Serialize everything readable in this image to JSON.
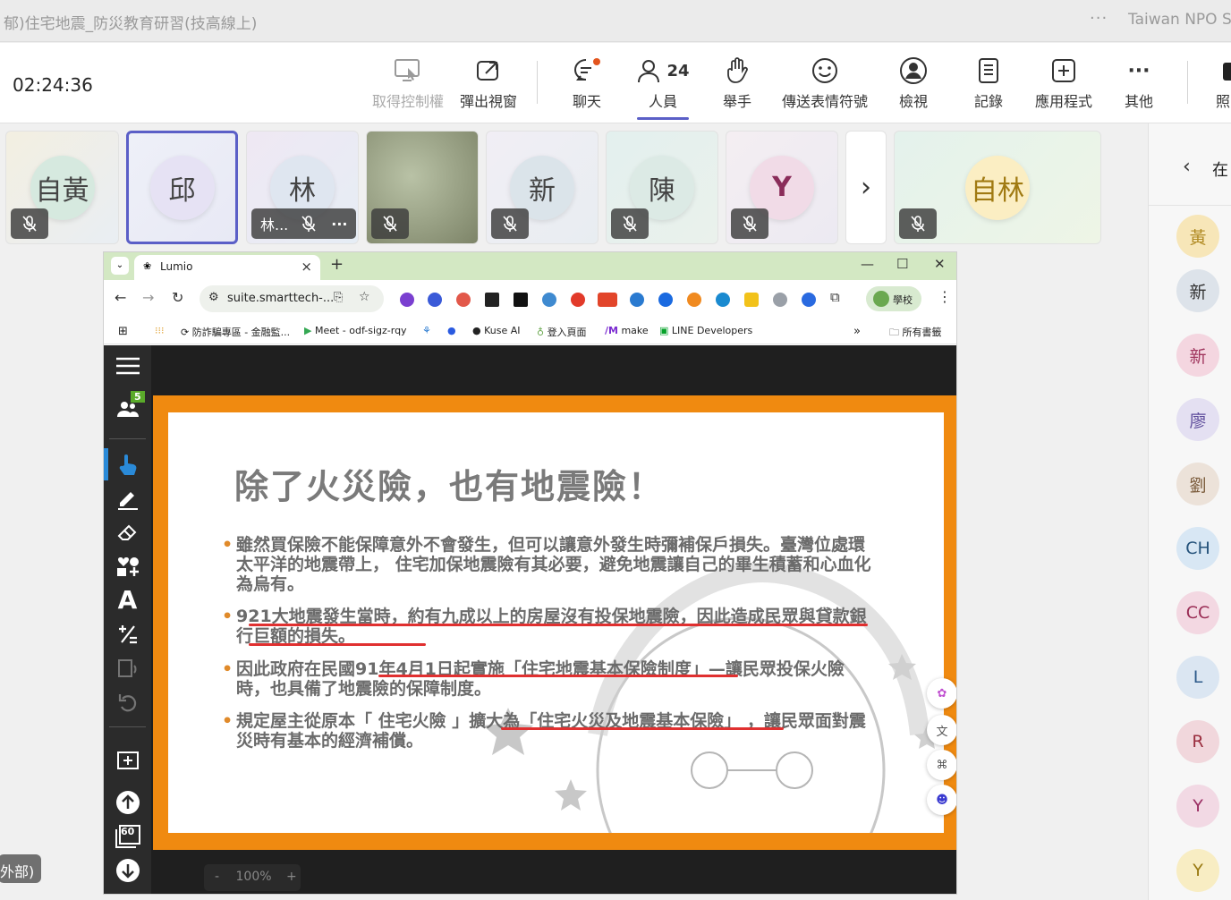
{
  "window": {
    "title": "郁)住宅地震_防災教育研習(技高線上)",
    "more_label": "···",
    "org": "Taiwan NPO Se"
  },
  "toolbar": {
    "timer": "02:24:36",
    "take_control": "取得控制權",
    "popout": "彈出視窗",
    "chat": "聊天",
    "people": "人員",
    "people_count": "24",
    "raise_hand": "舉手",
    "react": "傳送表情符號",
    "view": "檢視",
    "notes": "記錄",
    "apps": "應用程式",
    "more": "其他",
    "camera": "照"
  },
  "tiles": [
    {
      "name": "自黃",
      "color": "#d6e9df"
    },
    {
      "name": "邱",
      "color": "#e6e2f4"
    },
    {
      "name": "林",
      "color": "#dfe6f0",
      "label": "林..."
    },
    {
      "name": "",
      "color": "#9aa58f"
    },
    {
      "name": "新",
      "color": "#dbe4ea"
    },
    {
      "name": "陳",
      "color": "#dceae5"
    },
    {
      "name": "Y",
      "color": "#f1dbe7"
    },
    {
      "name": "自林",
      "color": "#fbeec3"
    }
  ],
  "tiles_next": "›",
  "roster": {
    "back": "‹",
    "title": "在",
    "people": [
      {
        "name": "黃",
        "color": "#f7e6b8"
      },
      {
        "name": "新",
        "color": "#dde3ea"
      },
      {
        "name": "新",
        "color": "#f4d6e0"
      },
      {
        "name": "廖",
        "color": "#e4e0f2"
      },
      {
        "name": "劉",
        "color": "#ece2d9"
      },
      {
        "name": "CH",
        "color": "#d8e7f4"
      },
      {
        "name": "CC",
        "color": "#f3d8e2"
      },
      {
        "name": "L",
        "color": "#dbe6f2"
      },
      {
        "name": "R",
        "color": "#f1d7dc"
      },
      {
        "name": "Y",
        "color": "#f2d9e4"
      },
      {
        "name": "Y",
        "color": "#f8edc3"
      }
    ]
  },
  "browser": {
    "tab_title": "Lumio",
    "url": "suite.smarttech-...",
    "school": "學校",
    "bookmarks": {
      "b1": "防詐騙專區 - 金融監...",
      "b2": "Meet - odf-sigz-rqy",
      "b3": "Kuse AI",
      "b4": "登入頁面",
      "b5": "make",
      "b6": "LINE Developers",
      "more": "»",
      "folder": "所有書籤"
    }
  },
  "lumio": {
    "participants": "5",
    "page_count": "60",
    "zoom": "100%",
    "zoom_minus": "-",
    "zoom_plus": "+"
  },
  "slide": {
    "title": "除了火災險，也有地震險！",
    "b1": "雖然買保險不能保障意外不會發生，但可以讓意外發生時彌補保戶損失。臺灣位處環太平洋的地震帶上， 住宅加保地震險有其必要，避免地震讓自己的畢生積蓄和心血化為烏有。",
    "b2": "921大地震發生當時，約有九成以上的房屋沒有投保地震險，因此造成民眾與貸款銀行巨額的損失。",
    "b3": "因此政府在民國91年4月1日起實施「住宅地震基本保險制度」—讓民眾投保火險時，也具備了地震險的保障制度。",
    "b4": "規定屋主從原本「 住宅火險 」擴大為「住宅火災及地震基本保險」 ，讓民眾面對震災時有基本的經濟補償。"
  },
  "external_badge": "外部)"
}
